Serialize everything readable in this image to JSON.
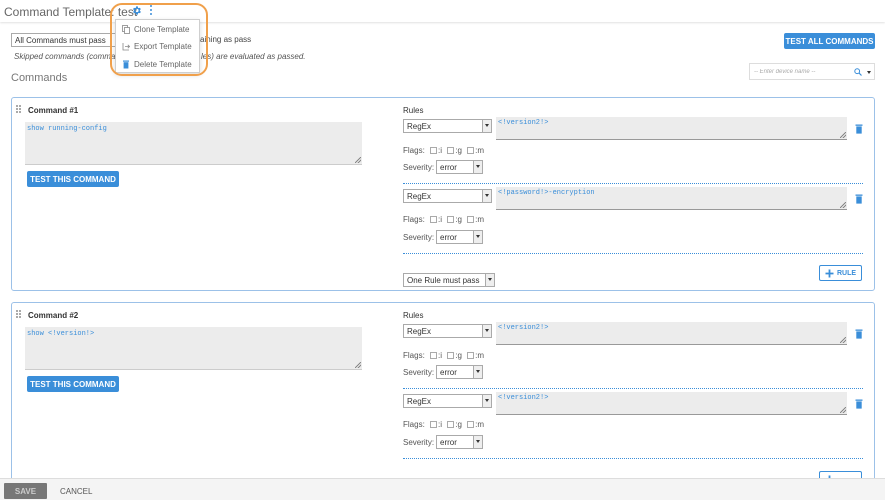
{
  "header": {
    "title": "Command Template: test",
    "settings_icon": "gear-icon",
    "more_icon": "kebab-icon"
  },
  "template_menu": {
    "items": [
      {
        "label": "Clone Template",
        "icon": "copy-icon"
      },
      {
        "label": "Export Template",
        "icon": "export-icon"
      },
      {
        "label": "Delete Template",
        "icon": "trash-icon"
      }
    ]
  },
  "options": {
    "pass_mode_value": "All Commands must pass",
    "warning_suffix": "aining as pass",
    "skipped_note_start": "Skipped commands (comma",
    "skipped_note_end": "les) are evaluated as passed."
  },
  "toolbar": {
    "test_all_label": "TEST ALL COMMANDS"
  },
  "commands_section": {
    "title": "Commands",
    "device_search_placeholder": "-- Enter device name --"
  },
  "commands": [
    {
      "label": "Command #1",
      "command_text": "show running-config",
      "test_label": "TEST THIS COMMAND",
      "rules_label": "Rules",
      "rules": [
        {
          "type": "RegEx",
          "pattern": "<!version2!>",
          "flags_label": "Flags:",
          "flag_i": ":i",
          "flag_g": ":g",
          "flag_m": ":m",
          "severity_label": "Severity:",
          "severity": "error"
        },
        {
          "type": "RegEx",
          "pattern": "<!password!>-encryption",
          "flags_label": "Flags:",
          "flag_i": ":i",
          "flag_g": ":g",
          "flag_m": ":m",
          "severity_label": "Severity:",
          "severity": "error"
        }
      ],
      "rule_mode": "One Rule must pass",
      "add_rule_label": "RULE"
    },
    {
      "label": "Command #2",
      "command_text": "show <!version!>",
      "test_label": "TEST THIS COMMAND",
      "rules_label": "Rules",
      "rules": [
        {
          "type": "RegEx",
          "pattern": "<!version2!>",
          "flags_label": "Flags:",
          "flag_i": ":i",
          "flag_g": ":g",
          "flag_m": ":m",
          "severity_label": "Severity:",
          "severity": "error"
        },
        {
          "type": "RegEx",
          "pattern": "<!version2!>",
          "flags_label": "Flags:",
          "flag_i": ":i",
          "flag_g": ":g",
          "flag_m": ":m",
          "severity_label": "Severity:",
          "severity": "error"
        }
      ]
    }
  ],
  "footer": {
    "save_label": "SAVE",
    "cancel_label": "CANCEL"
  },
  "colors": {
    "accent": "#3a8ed9",
    "highlight_ring": "#f0a04b",
    "card_border": "#9cc1e8"
  }
}
